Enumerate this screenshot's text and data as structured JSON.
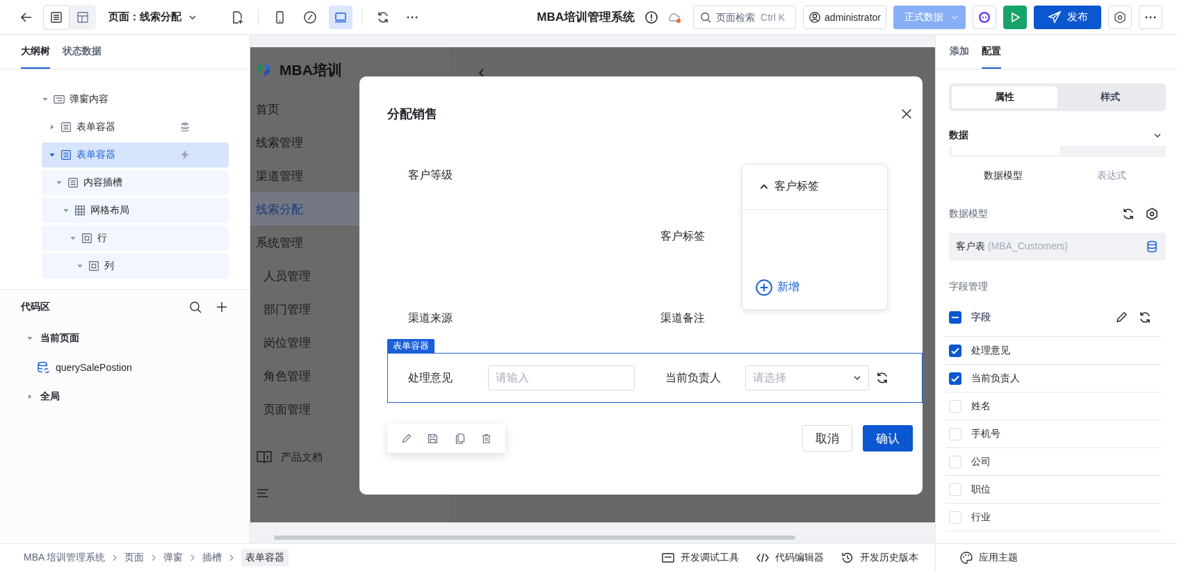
{
  "topbar": {
    "view_modes": [
      {
        "kind": "outline",
        "selected": true
      },
      {
        "kind": "layout",
        "selected": false
      }
    ],
    "page_select": "页面：线索分配",
    "devices": [
      {
        "kind": "mobile",
        "selected": false
      },
      {
        "kind": "miniapp",
        "selected": false
      },
      {
        "kind": "desktop",
        "selected": true
      }
    ],
    "app_title": "MBA培训管理系统",
    "search": {
      "placeholder": "页面检索",
      "shortcut": "Ctrl K"
    },
    "user": "administrator",
    "data_env": {
      "label": "正式数据",
      "disabled": true
    },
    "publish": "发布"
  },
  "outline": {
    "tabs": [
      {
        "label": "大纲树",
        "selected": true
      },
      {
        "label": "状态数据",
        "selected": false
      }
    ],
    "tree": [
      {
        "label": "弹窗内容",
        "kind": "dialog",
        "expanded": true,
        "selected": false,
        "children": [
          {
            "label": "表单容器",
            "kind": "form",
            "bound_data": true,
            "expanded": false,
            "selected": false
          },
          {
            "label": "表单容器",
            "kind": "form",
            "has_events": true,
            "expanded": true,
            "selected": true,
            "children": [
              {
                "label": "内容插槽",
                "kind": "form",
                "expanded": true,
                "selected": false,
                "children": [
                  {
                    "label": "网格布局",
                    "kind": "grid",
                    "expanded": true,
                    "selected": false,
                    "children": [
                      {
                        "label": "行",
                        "kind": "frame",
                        "expanded": true,
                        "selected": false,
                        "children": [
                          {
                            "label": "列",
                            "kind": "frame",
                            "expanded": true,
                            "selected": false
                          }
                        ]
                      }
                    ]
                  }
                ]
              }
            ]
          }
        ]
      }
    ]
  },
  "code_area": {
    "title": "代码区",
    "groups": [
      {
        "label": "当前页面",
        "expanded": true,
        "items": [
          {
            "label": "querySalePostion"
          }
        ]
      },
      {
        "label": "全局",
        "expanded": false
      }
    ]
  },
  "preview": {
    "brand": "MBA培训",
    "menu": [
      {
        "label": "首页",
        "selected": false
      },
      {
        "label": "线索管理",
        "selected": false
      },
      {
        "label": "渠道管理",
        "selected": false
      },
      {
        "label": "线索分配",
        "selected": true
      },
      {
        "label": "系统管理",
        "selected": false,
        "children": [
          {
            "label": "人员管理",
            "selected": false
          },
          {
            "label": "部门管理",
            "selected": false
          },
          {
            "label": "岗位管理",
            "selected": false
          },
          {
            "label": "角色管理",
            "selected": false
          },
          {
            "label": "页面管理",
            "selected": false
          }
        ]
      }
    ],
    "docs": "产品文档"
  },
  "dialog": {
    "title": "分配销售",
    "customer_level": {
      "label": "客户等级"
    },
    "customer_tags": {
      "label": "客户标签",
      "panel": {
        "title": "客户标签",
        "expanded": true,
        "add": "新增"
      }
    },
    "channel_source": {
      "label": "渠道来源"
    },
    "channel_note": {
      "label": "渠道备注"
    },
    "form_container": {
      "tag": "表单容器",
      "opinion": {
        "label": "处理意见",
        "placeholder": "请输入"
      },
      "owner": {
        "label": "当前负责人",
        "placeholder": "请选择"
      }
    },
    "buttons": {
      "cancel": "取消",
      "confirm": "确认"
    }
  },
  "config": {
    "tabs": [
      {
        "label": "添加",
        "selected": false
      },
      {
        "label": "配置",
        "selected": true
      }
    ],
    "modes": [
      {
        "label": "属性",
        "selected": true
      },
      {
        "label": "样式",
        "selected": false
      }
    ],
    "data_section": {
      "title": "数据",
      "expanded": true
    },
    "source_options": [
      {
        "label": "数据模型",
        "selected": true
      },
      {
        "label": "表达式",
        "selected": false
      }
    ],
    "model": {
      "label": "数据模型",
      "value": "客户表",
      "hint": "(MBA_Customers)"
    },
    "field_manager": {
      "title": "字段管理",
      "header": {
        "label": "字段",
        "indeterminate": true
      },
      "fields": [
        {
          "label": "处理意见",
          "checked": true
        },
        {
          "label": "当前负责人",
          "checked": true
        },
        {
          "label": "姓名",
          "checked": false
        },
        {
          "label": "手机号",
          "checked": false
        },
        {
          "label": "公司",
          "checked": false
        },
        {
          "label": "职位",
          "checked": false
        },
        {
          "label": "行业",
          "checked": false
        }
      ]
    }
  },
  "statusbar": {
    "breadcrumb": [
      "MBA 培训管理系统",
      "页面",
      "弹窗",
      "插槽",
      "表单容器"
    ],
    "tools": [
      {
        "kind": "debug",
        "label": "开发调试工具"
      },
      {
        "kind": "code",
        "label": "代码编辑器"
      },
      {
        "kind": "history",
        "label": "开发历史版本"
      },
      {
        "kind": "theme",
        "label": "应用主题"
      }
    ]
  }
}
